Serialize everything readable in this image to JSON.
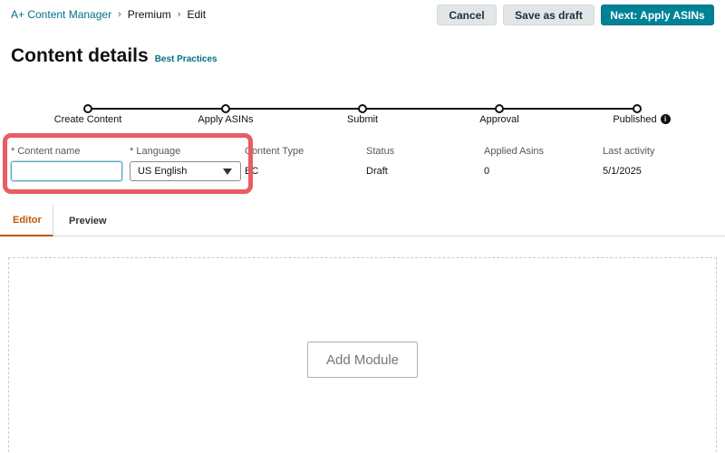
{
  "breadcrumb": {
    "items": [
      {
        "label": "A+ Content Manager",
        "link": true
      },
      {
        "label": "Premium",
        "link": false
      },
      {
        "label": "Edit",
        "link": false
      }
    ],
    "separator": "›"
  },
  "toolbar": {
    "cancel_label": "Cancel",
    "save_draft_label": "Save as draft",
    "next_label": "Next: Apply ASINs"
  },
  "header": {
    "title": "Content details",
    "best_practices_link": "Best Practices"
  },
  "stepper": {
    "steps": [
      {
        "label": "Create Content"
      },
      {
        "label": "Apply ASINs"
      },
      {
        "label": "Submit"
      },
      {
        "label": "Approval"
      },
      {
        "label": "Published"
      }
    ],
    "info_icon_glyph": "i"
  },
  "details": {
    "content_name": {
      "required_mark": "*",
      "label": "Content name",
      "value": "",
      "placeholder": ""
    },
    "language": {
      "required_mark": "*",
      "label": "Language",
      "selected": "US English"
    },
    "content_type": {
      "label": "Content Type",
      "value": "BC"
    },
    "status": {
      "label": "Status",
      "value": "Draft"
    },
    "applied_asins": {
      "label": "Applied Asins",
      "value": "0"
    },
    "last_activity": {
      "label": "Last activity",
      "value": "5/1/2025"
    }
  },
  "tabs": [
    {
      "label": "Editor",
      "active": true
    },
    {
      "label": "Preview",
      "active": false
    }
  ],
  "editor": {
    "add_module_label": "Add Module"
  },
  "colors": {
    "primary_button": "#008296",
    "link": "#007185",
    "active_tab": "#c45500",
    "highlight_box": "#e85c64"
  }
}
